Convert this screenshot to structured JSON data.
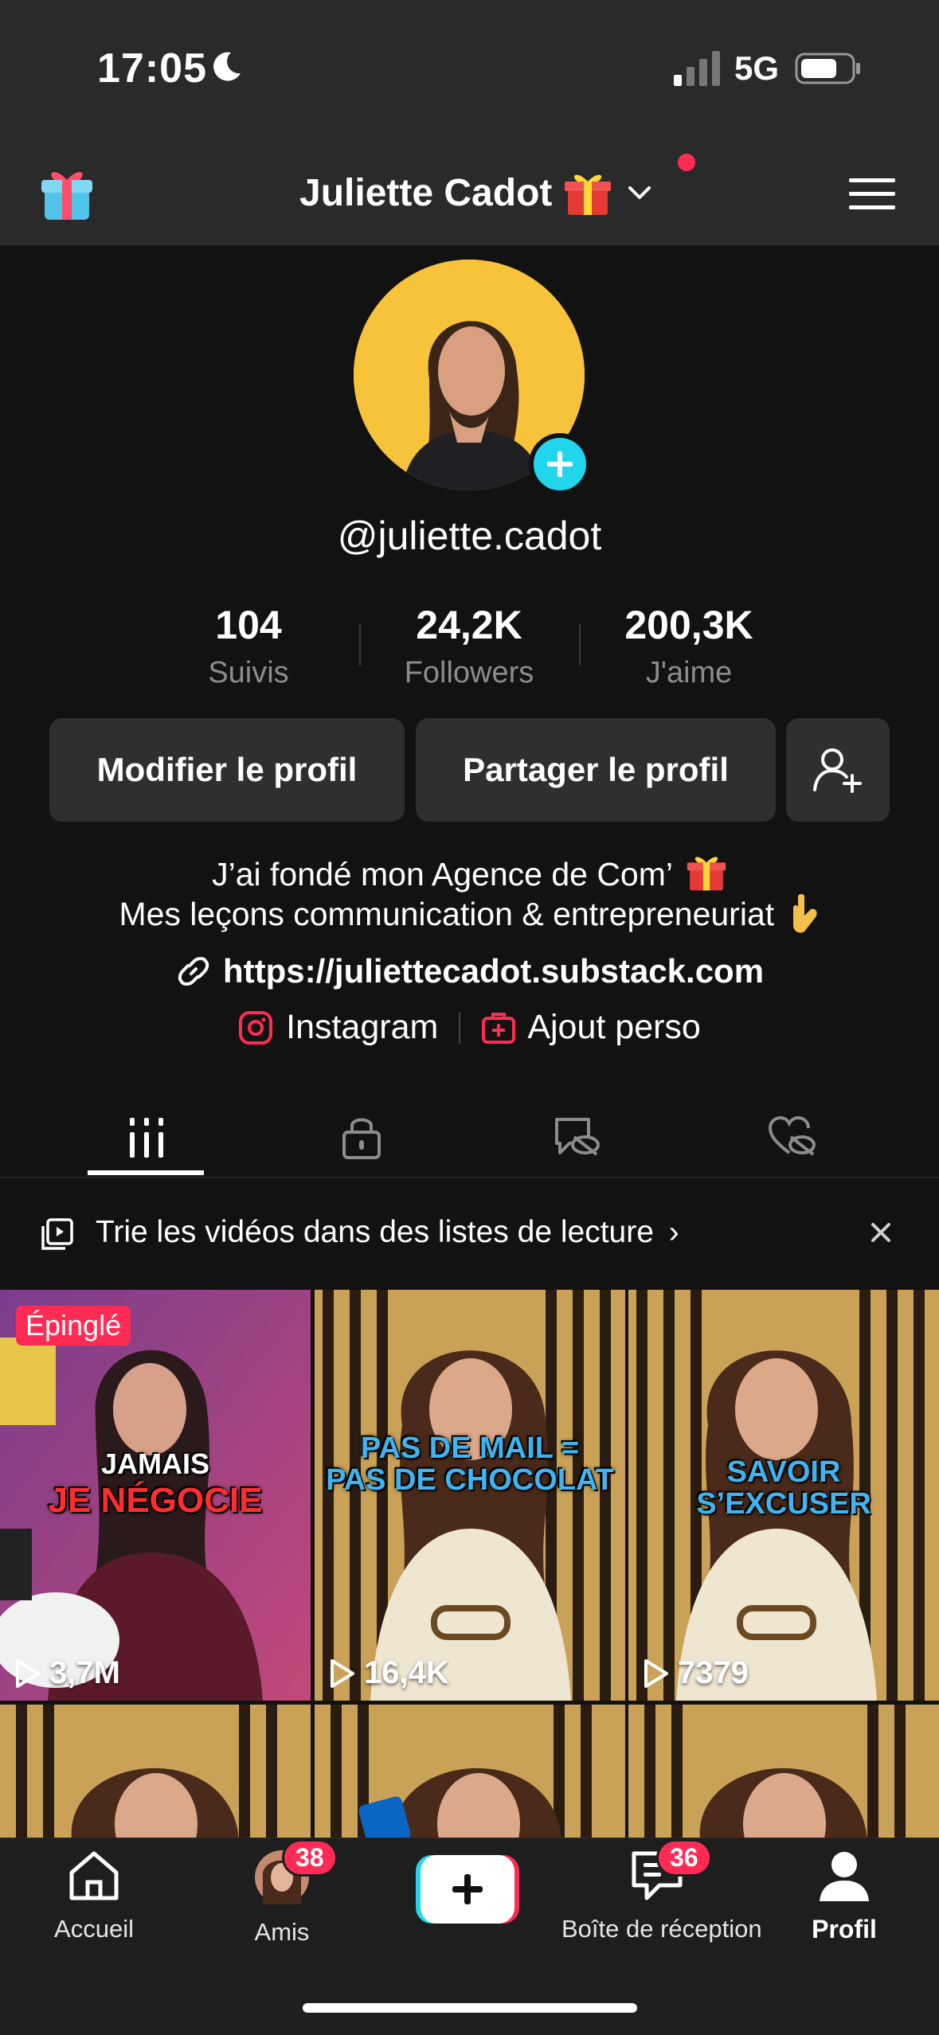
{
  "status_bar": {
    "time": "17:05",
    "network": "5G"
  },
  "header": {
    "title": "Juliette Cadot"
  },
  "profile": {
    "username": "@juliette.cadot",
    "stats": [
      {
        "value": "104",
        "label": "Suivis"
      },
      {
        "value": "24,2K",
        "label": "Followers"
      },
      {
        "value": "200,3K",
        "label": "J'aime"
      }
    ],
    "edit_label": "Modifier le profil",
    "share_label": "Partager le profil",
    "bio_line1": "J’ai fondé mon Agence de Com’",
    "bio_line2": "Mes leçons communication & entrepreneuriat",
    "link": "https://juliettecadot.substack.com",
    "instagram_label": "Instagram",
    "ajout_label": "Ajout perso"
  },
  "playlist_banner": {
    "text": "Trie les vidéos dans des listes de lecture"
  },
  "videos": [
    {
      "pinned_label": "Épinglé",
      "caption_top": "JAMAIS",
      "caption_bottom": "JE NÉGOCIE",
      "views": "3,7M"
    },
    {
      "caption_top": "PAS DE MAIL =",
      "caption_bottom": "PAS DE CHOCOLAT",
      "views": "16,4K"
    },
    {
      "caption_top": "SAVOIR",
      "caption_bottom": "S’EXCUSER",
      "views": "7379"
    }
  ],
  "bottom_nav": {
    "home": "Accueil",
    "friends": "Amis",
    "friends_badge": "38",
    "inbox": "Boîte de réception",
    "inbox_badge": "36",
    "profile": "Profil"
  },
  "colors": {
    "accent_pink": "#fe2c55",
    "accent_cyan": "#20d5ec",
    "avatar_bg": "#f6c33a"
  }
}
